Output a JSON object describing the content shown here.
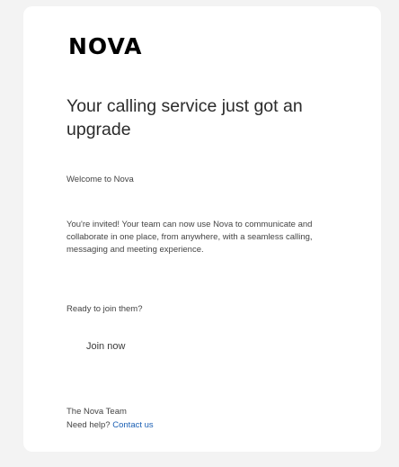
{
  "email": {
    "brand": "NOVA",
    "headline": "Your calling service just got an upgrade",
    "greeting": "Welcome to Nova",
    "body": "You're invited! Your team can now use Nova to communicate and collaborate in one place, from anywhere, with a seamless calling, messaging and meeting experience.",
    "prompt": "Ready to join them?",
    "cta_label": "Join now",
    "signature": "The Nova Team",
    "help_prefix": "Need help?",
    "help_link": "Contact us"
  },
  "colors": {
    "background": "#f3f3f3",
    "card": "#ffffff",
    "link": "#1a5fb4",
    "text": "#333333"
  }
}
